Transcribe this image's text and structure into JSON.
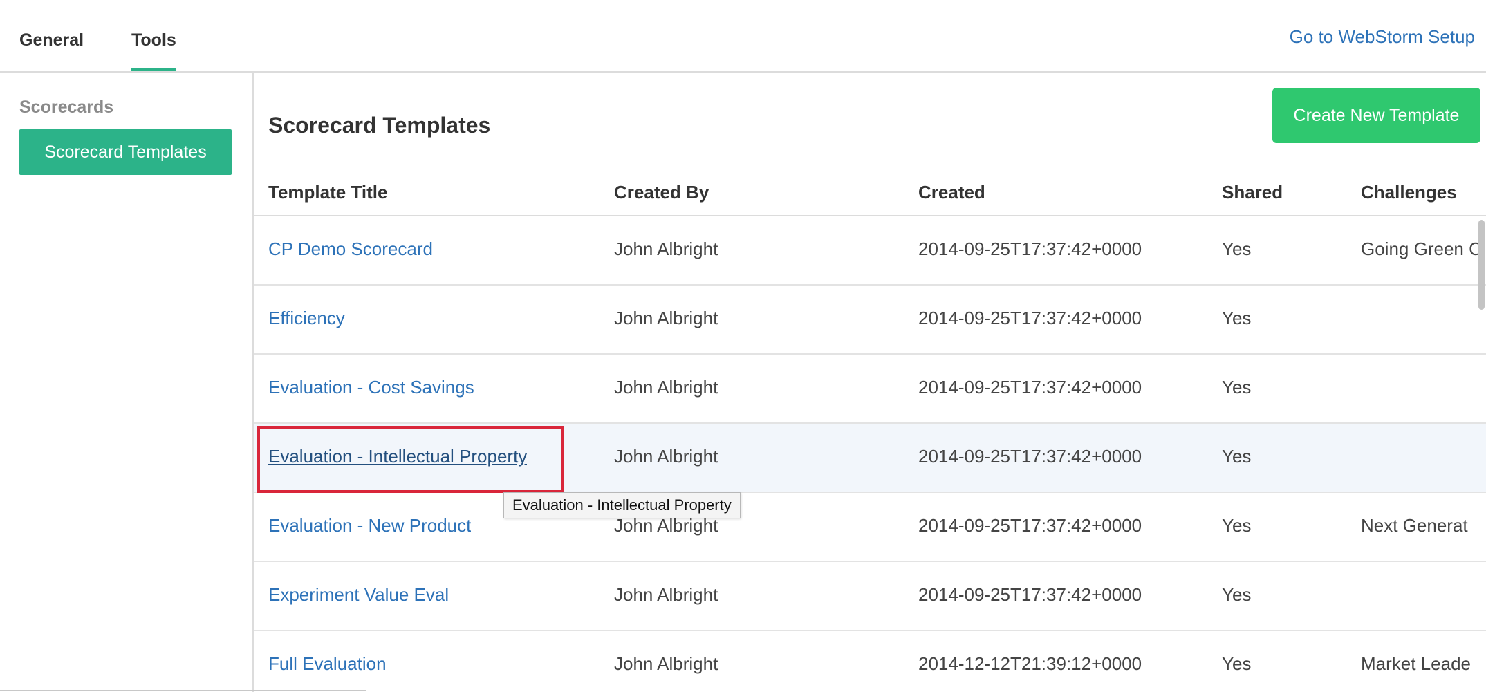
{
  "top_tabs": {
    "general": "General",
    "tools": "Tools"
  },
  "setup_link": "Go to WebStorm Setup",
  "sidebar": {
    "heading": "Scorecards",
    "active_item": "Scorecard Templates"
  },
  "main": {
    "title": "Scorecard Templates",
    "create_button": "Create New Template"
  },
  "table": {
    "columns": [
      "Template Title",
      "Created By",
      "Created",
      "Shared",
      "Challenges"
    ],
    "rows": [
      {
        "title": "CP Demo Scorecard",
        "created_by": "John Albright",
        "created": "2014-09-25T17:37:42+0000",
        "shared": "Yes",
        "challenges": "Going Green C"
      },
      {
        "title": "Efficiency",
        "created_by": "John Albright",
        "created": "2014-09-25T17:37:42+0000",
        "shared": "Yes",
        "challenges": ""
      },
      {
        "title": "Evaluation - Cost Savings",
        "created_by": "John Albright",
        "created": "2014-09-25T17:37:42+0000",
        "shared": "Yes",
        "challenges": ""
      },
      {
        "title": "Evaluation - Intellectual Property",
        "created_by": "John Albright",
        "created": "2014-09-25T17:37:42+0000",
        "shared": "Yes",
        "challenges": ""
      },
      {
        "title": "Evaluation - New Product",
        "created_by": "John Albright",
        "created": "2014-09-25T17:37:42+0000",
        "shared": "Yes",
        "challenges": "Next Generat"
      },
      {
        "title": "Experiment Value Eval",
        "created_by": "John Albright",
        "created": "2014-09-25T17:37:42+0000",
        "shared": "Yes",
        "challenges": ""
      },
      {
        "title": "Full Evaluation",
        "created_by": "John Albright",
        "created": "2014-12-12T21:39:12+0000",
        "shared": "Yes",
        "challenges": "Market Leade"
      }
    ]
  },
  "tooltip": "Evaluation - Intellectual Property",
  "colors": {
    "accent_green": "#2cb389",
    "button_green": "#2fc86f",
    "link_blue": "#2d72b8",
    "highlight_red": "#d9263a"
  }
}
